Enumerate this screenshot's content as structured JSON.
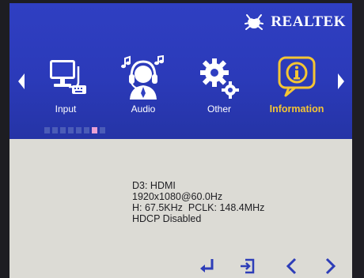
{
  "brand": {
    "name": "REALTEK"
  },
  "menu": {
    "items": [
      {
        "label": "Input",
        "icon": "monitor-input-icon"
      },
      {
        "label": "Audio",
        "icon": "headset-audio-icon"
      },
      {
        "label": "Other",
        "icon": "gears-icon"
      },
      {
        "label": "Information",
        "icon": "info-icon",
        "active": true
      }
    ],
    "accent_color": "#f4c534",
    "page_indicator": {
      "count": 8,
      "active_index": 6
    }
  },
  "info": {
    "line1": "D3: HDMI",
    "line2": "1920x1080@60.0Hz",
    "line3": "H: 67.5KHz  PCLK: 148.4MHz",
    "line4": "HDCP Disabled"
  },
  "footer": {
    "buttons": [
      "enter-icon",
      "exit-icon",
      "left-arrow-icon",
      "right-arrow-icon"
    ],
    "color": "#2d3db8"
  }
}
